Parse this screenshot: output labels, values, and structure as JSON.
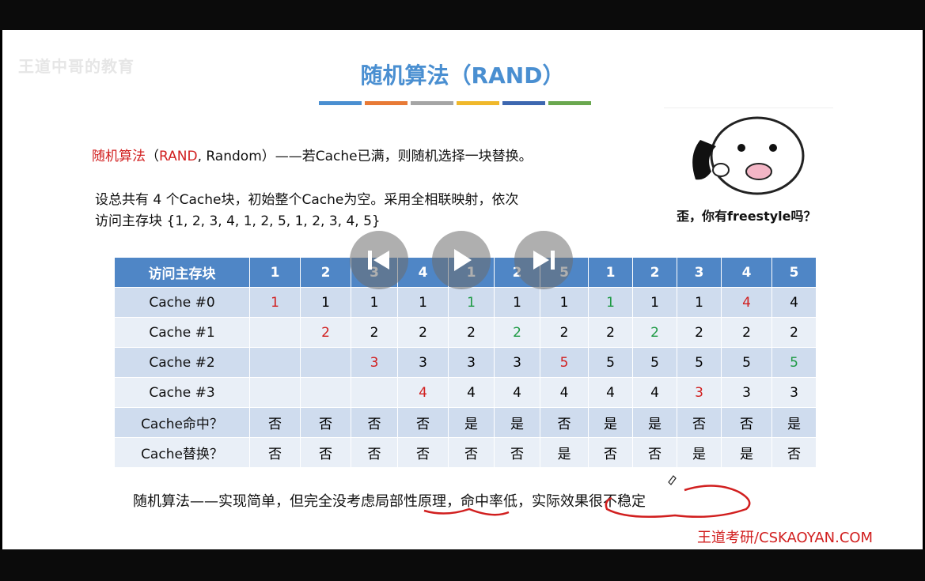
{
  "watermark": "王道中哥的教育",
  "title": "随机算法（RAND）",
  "stripe_colors": [
    "#4a8fd1",
    "#e87a36",
    "#a5a5a5",
    "#f0b82b",
    "#3d67b0",
    "#6aa84f"
  ],
  "definition": {
    "term": "随机算法",
    "paren_open": "（",
    "rand": "RAND",
    "rest": ", Random）——若Cache已满，则随机选择一块替换。"
  },
  "setup": {
    "line1": "设总共有 4 个Cache块，初始整个Cache为空。采用全相联映射，依次",
    "line2": "访问主存块 {1, 2, 3, 4, 1, 2, 5, 1, 2, 3, 4, 5}"
  },
  "meme_caption": "歪，你有freestyle吗？",
  "table": {
    "header_label": "访问主存块",
    "accesses": [
      "1",
      "2",
      "3",
      "4",
      "1",
      "2",
      "5",
      "1",
      "2",
      "3",
      "4",
      "5"
    ],
    "rows": [
      {
        "label": "Cache #0",
        "cells": [
          {
            "v": "1",
            "c": "red"
          },
          {
            "v": "1",
            "c": ""
          },
          {
            "v": "1",
            "c": ""
          },
          {
            "v": "1",
            "c": ""
          },
          {
            "v": "1",
            "c": "green"
          },
          {
            "v": "1",
            "c": ""
          },
          {
            "v": "1",
            "c": ""
          },
          {
            "v": "1",
            "c": "green"
          },
          {
            "v": "1",
            "c": ""
          },
          {
            "v": "1",
            "c": ""
          },
          {
            "v": "4",
            "c": "red"
          },
          {
            "v": "4",
            "c": ""
          }
        ]
      },
      {
        "label": "Cache #1",
        "cells": [
          {
            "v": "",
            "c": ""
          },
          {
            "v": "2",
            "c": "red"
          },
          {
            "v": "2",
            "c": ""
          },
          {
            "v": "2",
            "c": ""
          },
          {
            "v": "2",
            "c": ""
          },
          {
            "v": "2",
            "c": "green"
          },
          {
            "v": "2",
            "c": ""
          },
          {
            "v": "2",
            "c": ""
          },
          {
            "v": "2",
            "c": "green"
          },
          {
            "v": "2",
            "c": ""
          },
          {
            "v": "2",
            "c": ""
          },
          {
            "v": "2",
            "c": ""
          }
        ]
      },
      {
        "label": "Cache #2",
        "cells": [
          {
            "v": "",
            "c": ""
          },
          {
            "v": "",
            "c": ""
          },
          {
            "v": "3",
            "c": "red"
          },
          {
            "v": "3",
            "c": ""
          },
          {
            "v": "3",
            "c": ""
          },
          {
            "v": "3",
            "c": ""
          },
          {
            "v": "5",
            "c": "red"
          },
          {
            "v": "5",
            "c": ""
          },
          {
            "v": "5",
            "c": ""
          },
          {
            "v": "5",
            "c": ""
          },
          {
            "v": "5",
            "c": ""
          },
          {
            "v": "5",
            "c": "green"
          }
        ]
      },
      {
        "label": "Cache #3",
        "cells": [
          {
            "v": "",
            "c": ""
          },
          {
            "v": "",
            "c": ""
          },
          {
            "v": "",
            "c": ""
          },
          {
            "v": "4",
            "c": "red"
          },
          {
            "v": "4",
            "c": ""
          },
          {
            "v": "4",
            "c": ""
          },
          {
            "v": "4",
            "c": ""
          },
          {
            "v": "4",
            "c": ""
          },
          {
            "v": "4",
            "c": ""
          },
          {
            "v": "3",
            "c": "red"
          },
          {
            "v": "3",
            "c": ""
          },
          {
            "v": "3",
            "c": ""
          }
        ]
      },
      {
        "label": "Cache命中？",
        "cells": [
          {
            "v": "否",
            "c": ""
          },
          {
            "v": "否",
            "c": ""
          },
          {
            "v": "否",
            "c": ""
          },
          {
            "v": "否",
            "c": ""
          },
          {
            "v": "是",
            "c": ""
          },
          {
            "v": "是",
            "c": ""
          },
          {
            "v": "否",
            "c": ""
          },
          {
            "v": "是",
            "c": ""
          },
          {
            "v": "是",
            "c": ""
          },
          {
            "v": "否",
            "c": ""
          },
          {
            "v": "否",
            "c": ""
          },
          {
            "v": "是",
            "c": ""
          }
        ]
      },
      {
        "label": "Cache替换？",
        "cells": [
          {
            "v": "否",
            "c": ""
          },
          {
            "v": "否",
            "c": ""
          },
          {
            "v": "否",
            "c": ""
          },
          {
            "v": "否",
            "c": ""
          },
          {
            "v": "否",
            "c": ""
          },
          {
            "v": "否",
            "c": ""
          },
          {
            "v": "是",
            "c": ""
          },
          {
            "v": "否",
            "c": ""
          },
          {
            "v": "否",
            "c": ""
          },
          {
            "v": "是",
            "c": ""
          },
          {
            "v": "是",
            "c": ""
          },
          {
            "v": "否",
            "c": ""
          }
        ]
      }
    ]
  },
  "controls": {
    "prev_icon": "skip-previous-icon",
    "play_icon": "play-icon",
    "next_icon": "skip-next-icon"
  },
  "conclusion": "随机算法——实现简单，但完全没考虑局部性原理，命中率低，实际效果很不稳定",
  "brand": "王道考研/CSKAOYAN.COM",
  "colors": {
    "red": "#d11f1f",
    "green": "#1e9a44",
    "header_blue": "#4f86c6",
    "title_blue": "#4a8fd1"
  }
}
